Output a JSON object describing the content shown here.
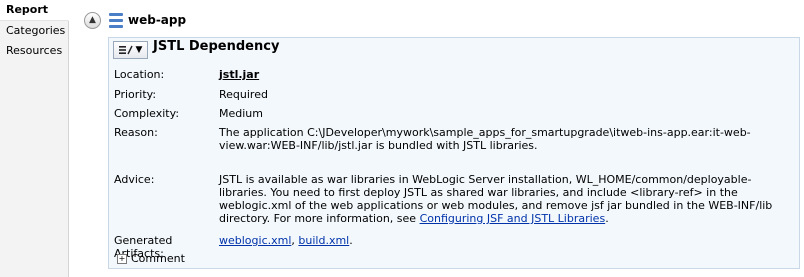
{
  "sidebar": {
    "items": [
      {
        "label": "Report"
      },
      {
        "label": "Categories"
      },
      {
        "label": "Resources"
      }
    ]
  },
  "header": {
    "app_name": "web-app"
  },
  "card": {
    "title": "JSTL Dependency",
    "location_label": "Location:",
    "location_value": "jstl.jar",
    "priority_label": "Priority:",
    "priority_value": "Required",
    "complexity_label": "Complexity:",
    "complexity_value": "Medium",
    "reason_label": "Reason:",
    "reason_value": "The application C:\\JDeveloper\\mywork\\sample_apps_for_smartupgrade\\itweb-ins-app.ear:it-web-view.war:WEB-INF/lib/jstl.jar is bundled with JSTL libraries.",
    "advice_label": "Advice:",
    "advice_text": "JSTL is available as war libraries in WebLogic Server installation, WL_HOME/common/deployable-libraries. You need to first deploy JSTL as shared war libraries, and include <library-ref> in the weblogic.xml of the web applications or web modules, and remove jsf jar bundled in the WEB-INF/lib directory. For more information, see ",
    "advice_link": "Configuring JSF and JSTL Libraries",
    "advice_tail": ".",
    "artifacts_label": "Generated Artifacts:",
    "artifact_1": "weblogic.xml",
    "artifact_sep": ", ",
    "artifact_2": "build.xml",
    "artifact_tail": ".",
    "comment_label": "Comment"
  }
}
